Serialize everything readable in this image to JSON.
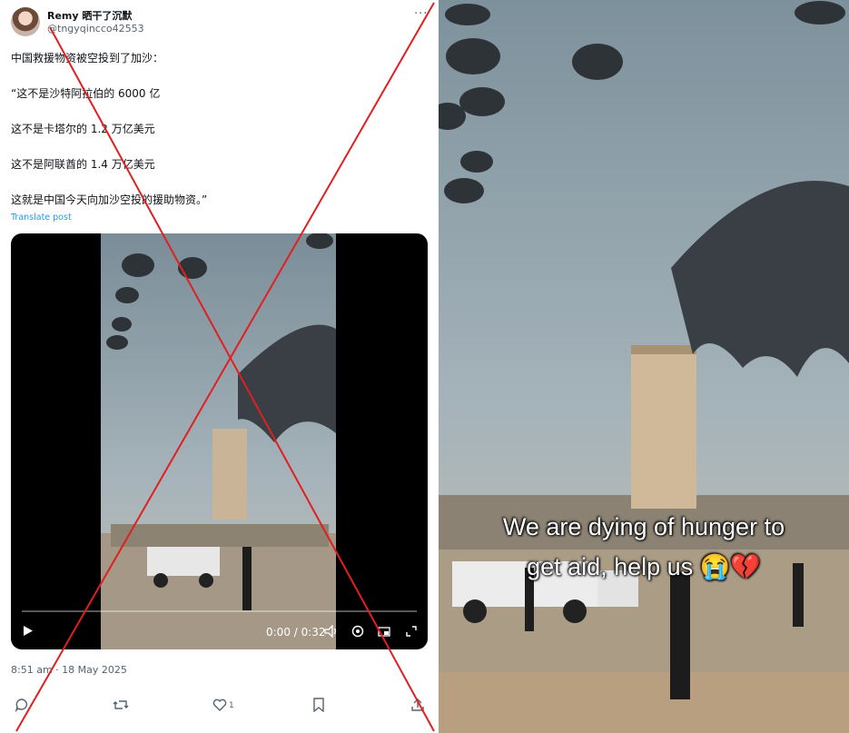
{
  "tweet": {
    "name": "Remy 晒干了沉默",
    "handle": "@tngyqincco42553",
    "more": "···",
    "lines": [
      "中国救援物资被空投到了加沙：",
      "“这不是沙特阿拉伯的 6000 亿",
      "这不是卡塔尔的 1.2 万亿美元",
      "这不是阿联酋的 1.4 万亿美元",
      "这就是中国今天向加沙空投的援助物资。”"
    ],
    "translate": "Translate post",
    "timestamp": "8:51 am · 18 May 2025",
    "video": {
      "time": "0:00 / 0:32",
      "play_icon": "play-icon",
      "volume_icon": "volume-icon",
      "settings_icon": "settings-icon",
      "pip_icon": "pip-icon",
      "fullscreen_icon": "fullscreen-icon"
    },
    "actions": {
      "like_count": "1"
    }
  },
  "right_panel": {
    "caption_line1": "We are dying of hunger to",
    "caption_line2": "get aid, help us 😭💔"
  },
  "colors": {
    "cross": "#e02020",
    "link": "#1d9bf0",
    "sky": "#8fa1aa"
  }
}
